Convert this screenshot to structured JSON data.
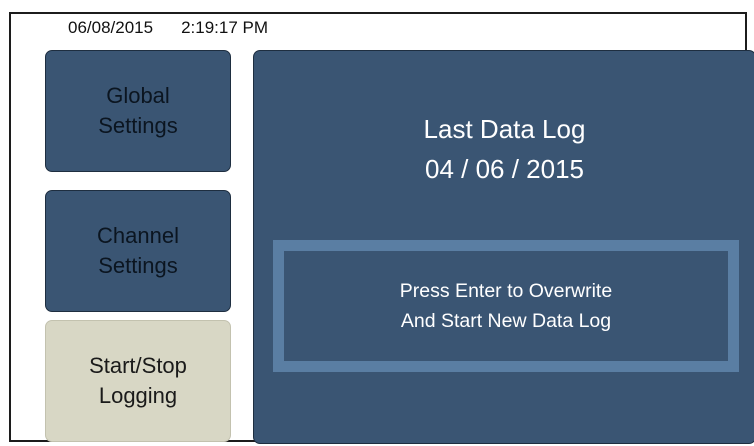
{
  "status": {
    "date": "06/08/2015",
    "time": "2:19:17 PM"
  },
  "menu": {
    "global_settings": [
      "Global",
      "Settings"
    ],
    "channel_settings": [
      "Channel",
      "Settings"
    ],
    "start_stop_logging": [
      "Start/Stop",
      "Logging"
    ]
  },
  "panel": {
    "title": "Last Data Log",
    "date": "04 / 06 / 2015",
    "prompt_line1": "Press Enter to Overwrite",
    "prompt_line2": "And Start New Data Log"
  },
  "colors": {
    "button_dark": "#3a5573",
    "button_active": "#d8d7c5",
    "prompt_border": "#5a7ea3"
  }
}
